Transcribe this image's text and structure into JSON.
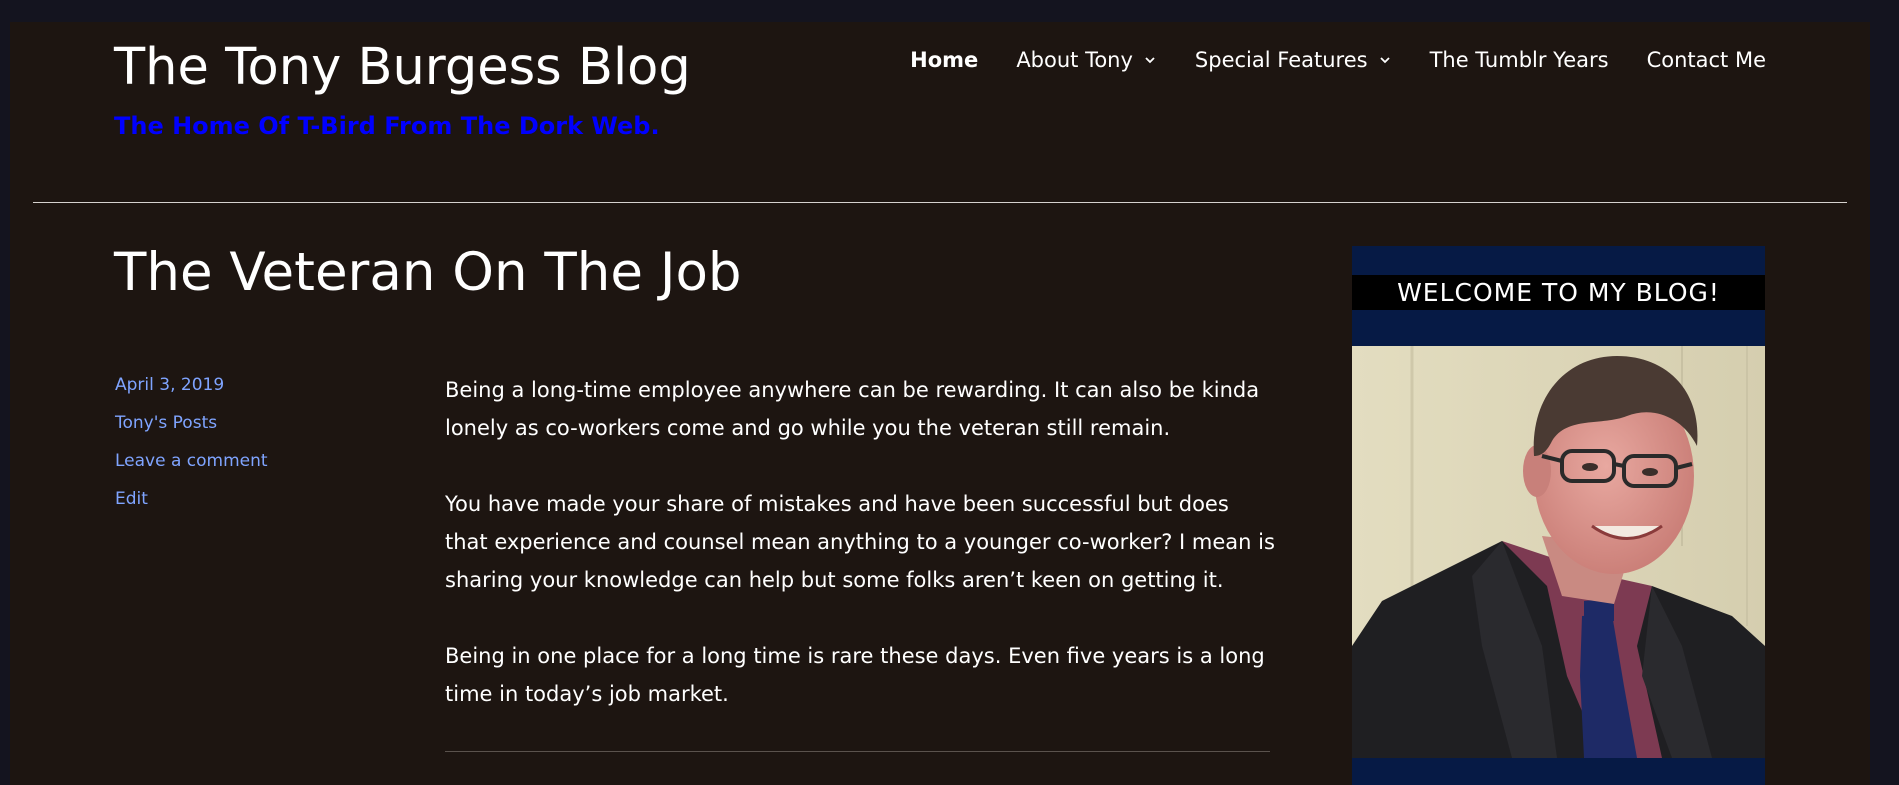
{
  "site": {
    "title": "The Tony Burgess Blog",
    "tagline": "The Home Of T-Bird From The Dork Web."
  },
  "nav": {
    "items": [
      {
        "label": "Home",
        "active": true,
        "has_submenu": false
      },
      {
        "label": "About Tony",
        "active": false,
        "has_submenu": true
      },
      {
        "label": "Special Features",
        "active": false,
        "has_submenu": true
      },
      {
        "label": "The Tumblr Years",
        "active": false,
        "has_submenu": false
      },
      {
        "label": "Contact Me",
        "active": false,
        "has_submenu": false
      }
    ]
  },
  "post": {
    "title": "The Veteran On The Job",
    "meta": {
      "date": "April 3, 2019",
      "category": "Tony's Posts",
      "comments": "Leave a comment",
      "edit": "Edit"
    },
    "paragraphs": [
      "Being a long-time employee anywhere can be rewarding. It can also be kinda lonely as co-workers come and go while you the veteran still remain.",
      "You have made your share of mistakes and have been successful but does that experience and counsel mean anything to a younger co-worker? I mean is sharing your knowledge can help but some folks aren’t keen on getting it.",
      "Being in one place for a long time is rare these days. Even five years is a long time in today’s job market."
    ]
  },
  "sidebar": {
    "welcome": "WELCOME TO MY BLOG!"
  },
  "colors": {
    "outer_background": "#14141f",
    "page_background": "#1d1511",
    "link": "#7fa4ff",
    "tagline": "#0000ff",
    "sidebar_background": "#061a45"
  }
}
